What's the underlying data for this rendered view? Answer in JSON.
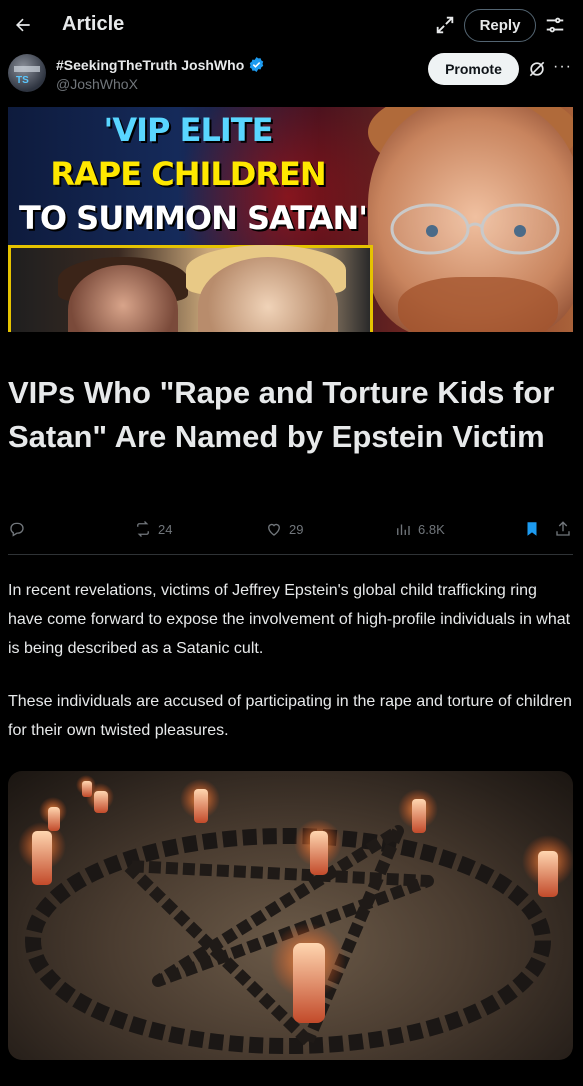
{
  "header": {
    "title": "Article",
    "reply_label": "Reply"
  },
  "author": {
    "name": "#SeekingTheTruth JoshWho",
    "handle": "@JoshWhoX",
    "avatar_text": "TS",
    "verified": true,
    "promote_label": "Promote"
  },
  "hero": {
    "line1": "'VIP ELITE",
    "line2": "RAPE CHILDREN",
    "line3": "TO SUMMON SATAN'"
  },
  "article": {
    "headline": "VIPs Who \"Rape and Torture Kids for Satan\" Are Named by Epstein Victim",
    "paragraph1": "In recent revelations, victims of Jeffrey Epstein's global child trafficking ring have come forward to expose the involvement of high-profile individuals in what is being described as a Satanic cult.",
    "paragraph2": "These individuals are accused of participating in the rape and torture of children for their own twisted pleasures."
  },
  "stats": {
    "reposts": "24",
    "likes": "29",
    "views": "6.8K"
  },
  "icons": {
    "back": "arrow-left-icon",
    "expand": "expand-icon",
    "filter": "sliders-icon",
    "grok": "grok-icon",
    "more": "more-icon",
    "reply": "reply-icon",
    "repost": "repost-icon",
    "like": "heart-icon",
    "views": "views-icon",
    "bookmark": "bookmark-icon",
    "share": "share-icon"
  },
  "colors": {
    "background": "#000000",
    "text": "#e7e9ea",
    "muted": "#71767b",
    "accent": "#1d9bf0",
    "promote_bg": "#eff3f4"
  }
}
